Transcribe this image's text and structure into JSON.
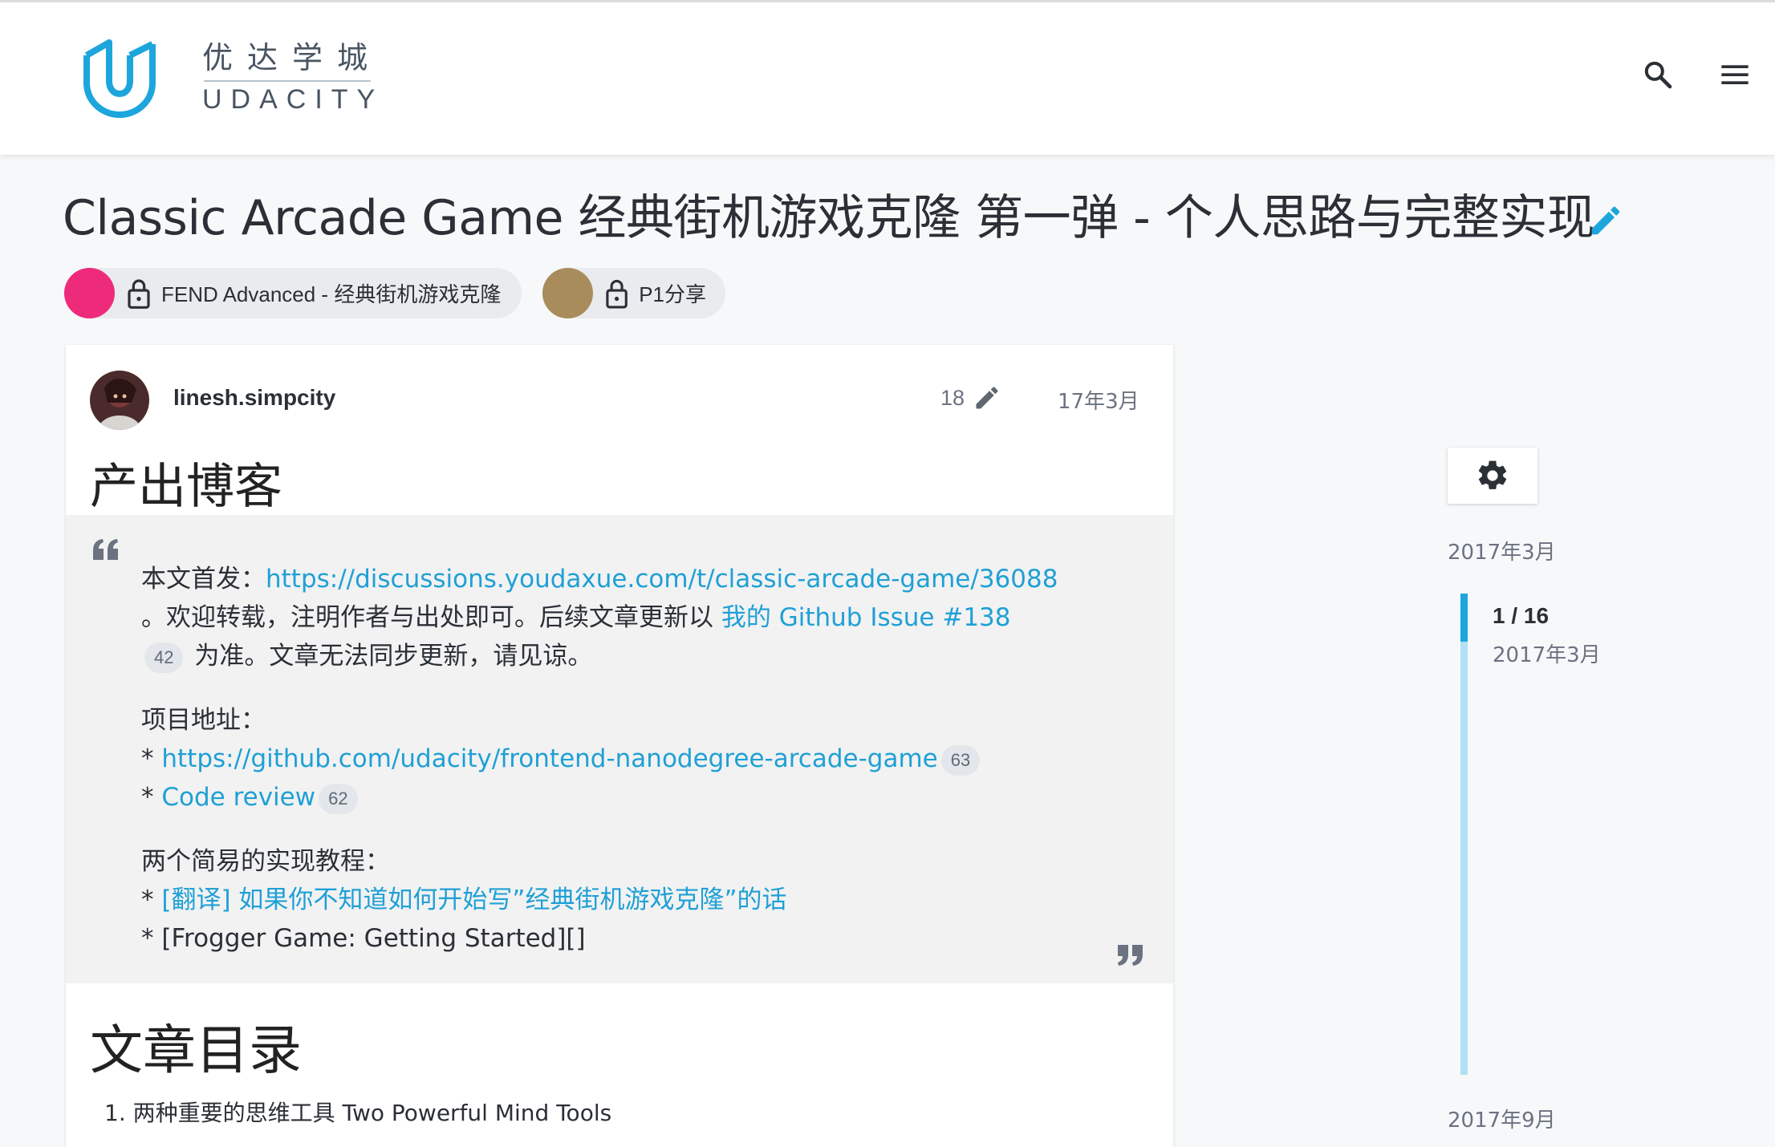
{
  "header": {
    "brand_cn": "优达学城",
    "brand_en": "UDACITY",
    "logo_icon": "udacity-logo",
    "search_icon": "search-icon",
    "menu_icon": "hamburger-menu-icon"
  },
  "topic": {
    "title": "Classic Arcade Game 经典街机游戏克隆 第一弹 - 个人思路与完整实现",
    "edit_icon": "pencil-icon"
  },
  "categories": [
    {
      "label": "FEND Advanced - 经典街机游戏克隆",
      "color": "#ee2a7b",
      "icon": "lock-icon"
    },
    {
      "label": "P1分享",
      "color": "#a98c5c",
      "icon": "lock-icon"
    }
  ],
  "post": {
    "username": "linesh.simpcity",
    "edit_count": "18",
    "date": "17年3月",
    "heading": "产出博客",
    "quote": {
      "line1_prefix": "本文首发：",
      "line1_link": "https://discussions.youdaxue.com/t/classic-arcade-game/36088",
      "line2_text": "。欢迎转载，注明作者与出处即可。后续文章更新以 ",
      "line2_link": "我的 Github Issue #138",
      "line3_badge": "42",
      "line3_text": " 为准。文章无法同步更新，请见谅。",
      "project_label": "项目地址：",
      "project_link1_prefix": "* ",
      "project_link1": "https://github.com/udacity/frontend-nanodegree-arcade-game",
      "project_link1_badge": "63",
      "project_link2_prefix": "* ",
      "project_link2": "Code review",
      "project_link2_badge": "62",
      "tutorials_label": "两个简易的实现教程：",
      "tutorial1_prefix": "* ",
      "tutorial1_link": "[翻译] 如果你不知道如何开始写”经典街机游戏克隆”的话",
      "tutorial2_text": "* [Frogger Game: Getting Started][]"
    },
    "toc_heading": "文章目录",
    "toc_items": [
      "1. 两种重要的思维工具 Two Powerful Mind Tools"
    ]
  },
  "timeline": {
    "gear_icon": "gear-icon",
    "start_date": "2017年3月",
    "position": "1 / 16",
    "position_date": "2017年3月",
    "end_date": "2017年9月",
    "progress": 0.0625
  },
  "colors": {
    "accent": "#1fa0d6",
    "timeline_track": "#b3e0f4",
    "timeline_handle": "#1ca6dc"
  }
}
